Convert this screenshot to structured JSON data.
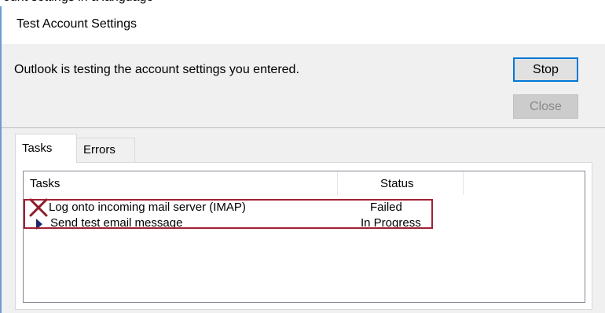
{
  "window": {
    "title": "Test Account Settings"
  },
  "message": "Outlook is testing the account settings you entered.",
  "buttons": {
    "stop_label": "Stop",
    "close_label": "Close"
  },
  "tabs": [
    {
      "label": "Tasks",
      "selected": true
    },
    {
      "label": "Errors",
      "selected": false
    }
  ],
  "table": {
    "columns": [
      "Tasks",
      "Status"
    ],
    "rows": [
      {
        "task": "Log onto incoming mail server (IMAP)",
        "status": "Failed",
        "icon": "failed-x-icon"
      },
      {
        "task": "Send test email message",
        "status": "In Progress",
        "icon": "in-progress-arrow-icon"
      }
    ]
  },
  "colors": {
    "failed_icon": "#8b1c2a",
    "highlight_border": "#a32034",
    "progress_arrow": "#1f2a6b",
    "stop_focus_border": "#0078d7"
  }
}
